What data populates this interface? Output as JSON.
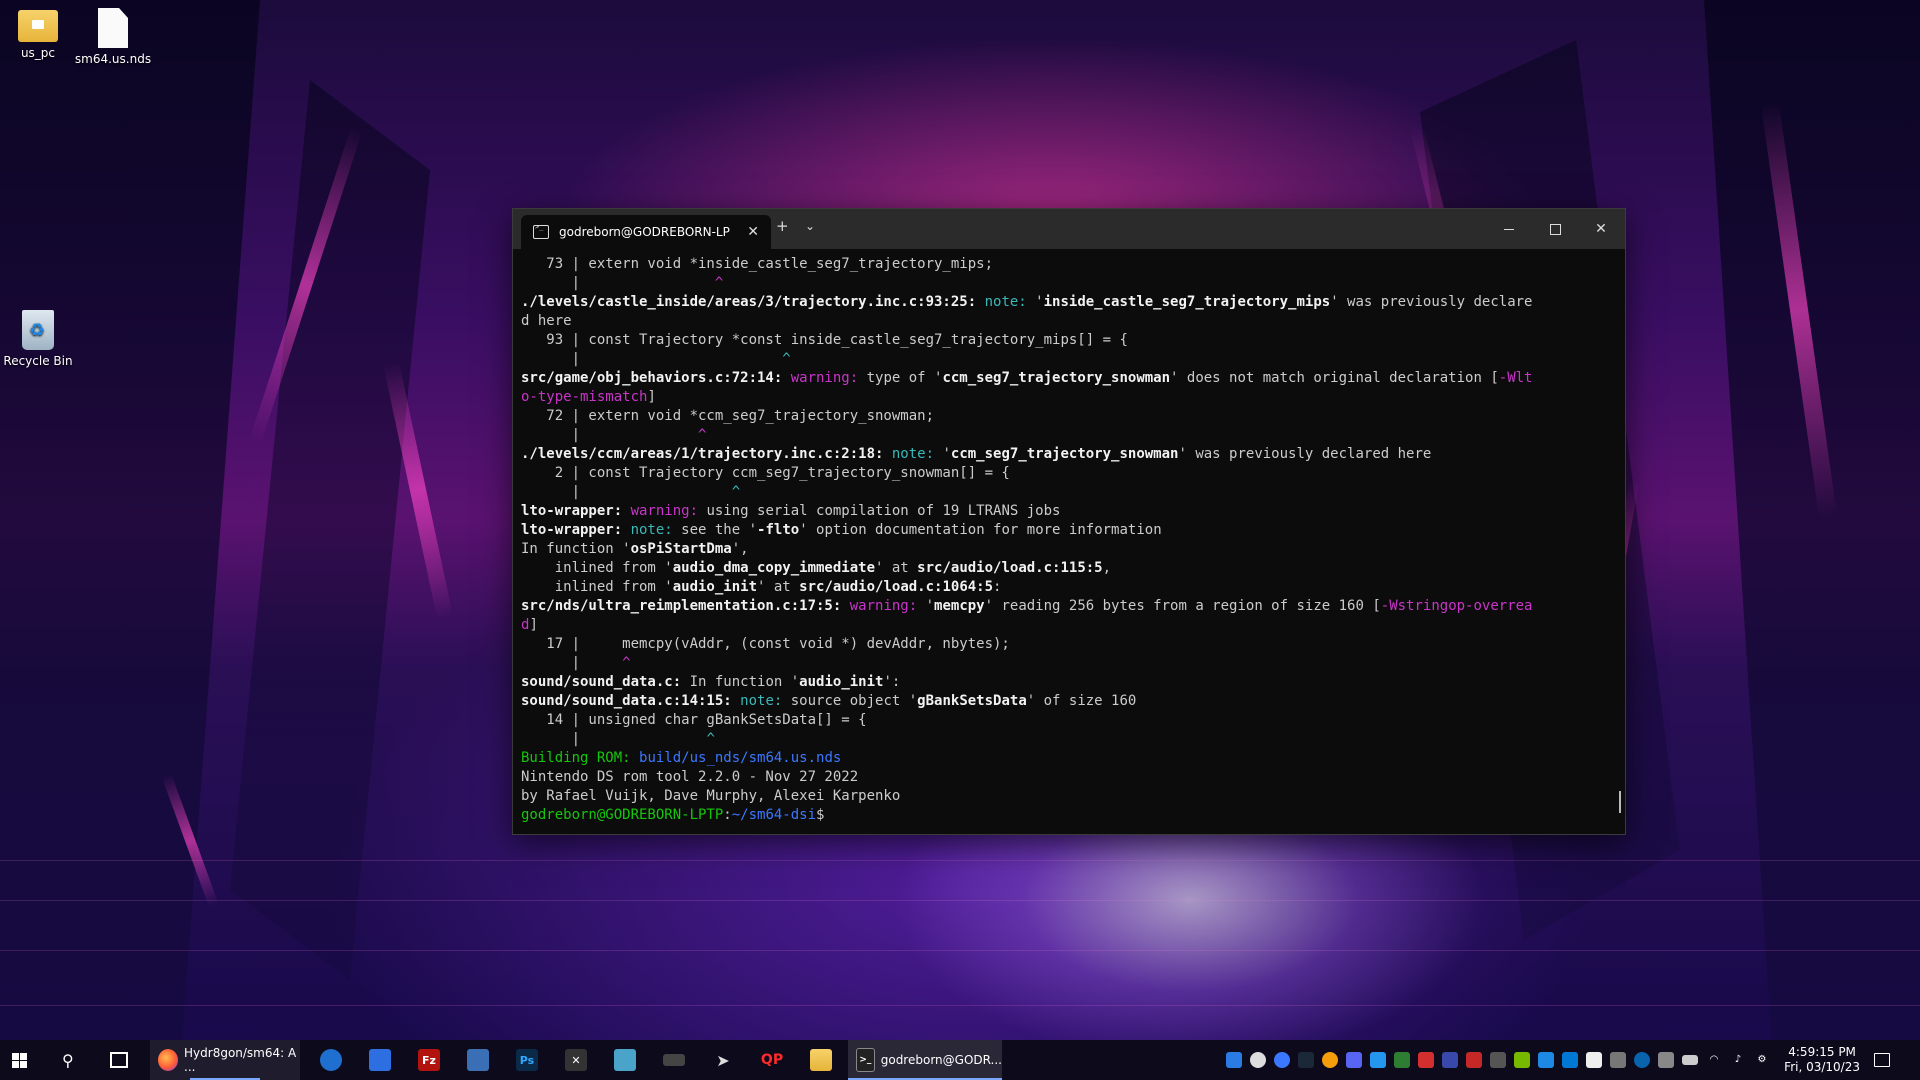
{
  "desktop": {
    "icons": [
      {
        "label": "us_pc",
        "icon": "folder-icon"
      },
      {
        "label": "sm64.us.nds",
        "icon": "file-icon"
      },
      {
        "label": "Recycle Bin",
        "icon": "recycle-bin-icon"
      }
    ]
  },
  "terminal": {
    "tab_title": "godreborn@GODREBORN-LP",
    "new_tab": "+",
    "dropdown": "⌄",
    "lines": [
      [
        {
          "t": "   73 | extern void *inside_castle_seg7_trajectory_mips;"
        }
      ],
      [
        {
          "t": "      |                ",
          "c": ""
        },
        {
          "t": "^",
          "c": "mag"
        }
      ],
      [
        {
          "t": "./levels/castle_inside/areas/3/trajectory.inc.c:93:25: ",
          "c": "b"
        },
        {
          "t": "note:",
          "c": "cyan"
        },
        {
          "t": " '"
        },
        {
          "t": "inside_castle_seg7_trajectory_mips",
          "c": "b"
        },
        {
          "t": "' was previously declare"
        }
      ],
      [
        {
          "t": "d here"
        }
      ],
      [
        {
          "t": "   93 | const Trajectory *const inside_castle_seg7_trajectory_mips[] = {"
        }
      ],
      [
        {
          "t": "      |                        "
        },
        {
          "t": "^",
          "c": "cyan"
        }
      ],
      [
        {
          "t": "src/game/obj_behaviors.c:72:14: ",
          "c": "b"
        },
        {
          "t": "warning:",
          "c": "mag"
        },
        {
          "t": " type of '"
        },
        {
          "t": "ccm_seg7_trajectory_snowman",
          "c": "b"
        },
        {
          "t": "' does not match original declaration ["
        },
        {
          "t": "-Wlt",
          "c": "mag"
        }
      ],
      [
        {
          "t": "o-type-mismatch",
          "c": "mag"
        },
        {
          "t": "]"
        }
      ],
      [
        {
          "t": "   72 | extern void *ccm_seg7_trajectory_snowman;"
        }
      ],
      [
        {
          "t": "      |              "
        },
        {
          "t": "^",
          "c": "mag"
        }
      ],
      [
        {
          "t": "./levels/ccm/areas/1/trajectory.inc.c:2:18: ",
          "c": "b"
        },
        {
          "t": "note:",
          "c": "cyan"
        },
        {
          "t": " '"
        },
        {
          "t": "ccm_seg7_trajectory_snowman",
          "c": "b"
        },
        {
          "t": "' was previously declared here"
        }
      ],
      [
        {
          "t": "    2 | const Trajectory ccm_seg7_trajectory_snowman[] = {"
        }
      ],
      [
        {
          "t": "      |                  "
        },
        {
          "t": "^",
          "c": "cyan"
        }
      ],
      [
        {
          "t": "lto-wrapper: ",
          "c": "b"
        },
        {
          "t": "warning:",
          "c": "mag"
        },
        {
          "t": " using serial compilation of 19 LTRANS jobs"
        }
      ],
      [
        {
          "t": "lto-wrapper: ",
          "c": "b"
        },
        {
          "t": "note:",
          "c": "cyan"
        },
        {
          "t": " see the '"
        },
        {
          "t": "-flto",
          "c": "b"
        },
        {
          "t": "' option documentation for more information"
        }
      ],
      [
        {
          "t": "In function '"
        },
        {
          "t": "osPiStartDma",
          "c": "b"
        },
        {
          "t": "',"
        }
      ],
      [
        {
          "t": "    inlined from '"
        },
        {
          "t": "audio_dma_copy_immediate",
          "c": "b"
        },
        {
          "t": "' at "
        },
        {
          "t": "src/audio/load.c:115:5",
          "c": "b"
        },
        {
          "t": ","
        }
      ],
      [
        {
          "t": "    inlined from '"
        },
        {
          "t": "audio_init",
          "c": "b"
        },
        {
          "t": "' at "
        },
        {
          "t": "src/audio/load.c:1064:5",
          "c": "b"
        },
        {
          "t": ":"
        }
      ],
      [
        {
          "t": "src/nds/ultra_reimplementation.c:17:5: ",
          "c": "b"
        },
        {
          "t": "warning:",
          "c": "mag"
        },
        {
          "t": " '"
        },
        {
          "t": "memcpy",
          "c": "b"
        },
        {
          "t": "' reading 256 bytes from a region of size 160 ["
        },
        {
          "t": "-Wstringop-overrea",
          "c": "mag"
        }
      ],
      [
        {
          "t": "d",
          "c": "mag"
        },
        {
          "t": "]"
        }
      ],
      [
        {
          "t": "   17 |     memcpy(vAddr, (const void *) devAddr, nbytes);"
        }
      ],
      [
        {
          "t": "      |     "
        },
        {
          "t": "^",
          "c": "mag"
        }
      ],
      [
        {
          "t": "sound/sound_data.c:",
          "c": "b"
        },
        {
          "t": " In function '"
        },
        {
          "t": "audio_init",
          "c": "b"
        },
        {
          "t": "':"
        }
      ],
      [
        {
          "t": "sound/sound_data.c:14:15: ",
          "c": "b"
        },
        {
          "t": "note:",
          "c": "cyan"
        },
        {
          "t": " source object '"
        },
        {
          "t": "gBankSetsData",
          "c": "b"
        },
        {
          "t": "' of size 160"
        }
      ],
      [
        {
          "t": "   14 | unsigned char gBankSetsData[] = {"
        }
      ],
      [
        {
          "t": "      |               "
        },
        {
          "t": "^",
          "c": "cyan"
        }
      ],
      [
        {
          "t": "Building ROM: ",
          "c": "grn"
        },
        {
          "t": "build/us_nds/sm64.us.nds",
          "c": "blu"
        }
      ],
      [
        {
          "t": "Nintendo DS rom tool 2.2.0 - Nov 27 2022"
        }
      ],
      [
        {
          "t": "by Rafael Vuijk, Dave Murphy, Alexei Karpenko"
        }
      ],
      [
        {
          "t": "godreborn@GODREBORN-LPTP",
          "c": "grn"
        },
        {
          "t": ":"
        },
        {
          "t": "~/sm64-dsi",
          "c": "blu"
        },
        {
          "t": "$"
        }
      ]
    ]
  },
  "taskbar": {
    "firefox_label": "Hydr8gon/sm64: A ...",
    "terminal_label": "godreborn@GODR...",
    "clock_time": "4:59:15 PM",
    "clock_date": "Fri, 03/10/23"
  }
}
